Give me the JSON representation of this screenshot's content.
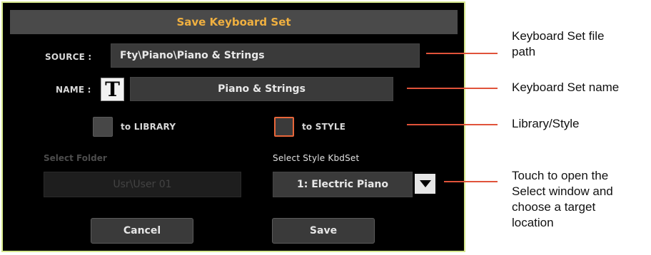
{
  "dialog": {
    "title": "Save Keyboard Set",
    "source": {
      "label": "SOURCE :",
      "value": "Fty\\Piano\\Piano & Strings"
    },
    "name": {
      "label": "NAME :",
      "text_button": "T",
      "value": "Piano & Strings"
    },
    "targets": {
      "library": {
        "label": "to LIBRARY",
        "checked": false
      },
      "style": {
        "label": "to STYLE",
        "checked": true
      }
    },
    "select_folder": {
      "label": "Select Folder",
      "value": "Usr\\User 01",
      "enabled": false
    },
    "select_style_kbdset": {
      "label": "Select Style KbdSet",
      "value": "1: Electric Piano"
    },
    "buttons": {
      "cancel": "Cancel",
      "save": "Save"
    }
  },
  "callouts": {
    "file_path": [
      "Keyboard Set file",
      "path"
    ],
    "name": "Keyboard Set name",
    "target": "Library/Style",
    "select": [
      "Touch to open the",
      "Select window and",
      "choose a target",
      "location"
    ]
  },
  "colors": {
    "dialog_bg": "#000000",
    "border": "#d7e88e",
    "title_text": "#f0b040",
    "selected_check": "#e8663a",
    "callout_line": "#e0533a"
  }
}
